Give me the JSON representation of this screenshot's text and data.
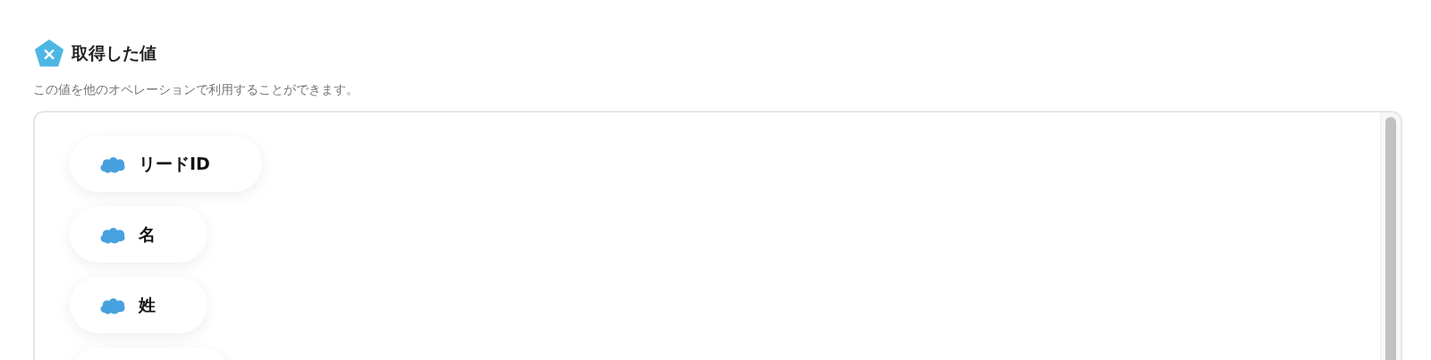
{
  "section": {
    "title": "取得した値",
    "description": "この値を他のオペレーションで利用することができます。"
  },
  "values": [
    {
      "label": "リードID"
    },
    {
      "label": "名"
    },
    {
      "label": "姓"
    }
  ]
}
